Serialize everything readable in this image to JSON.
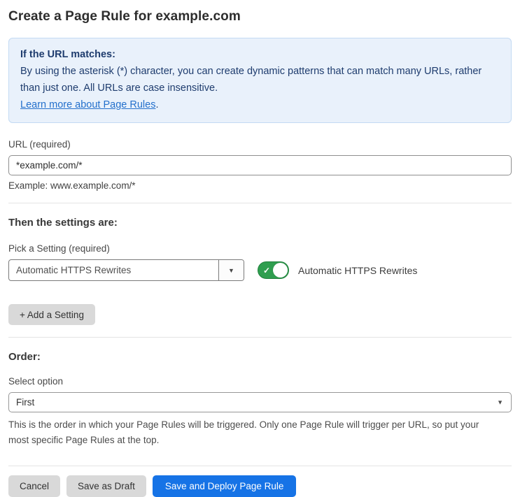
{
  "page": {
    "title": "Create a Page Rule for example.com"
  },
  "info_box": {
    "heading": "If the URL matches:",
    "body": "By using the asterisk (*) character, you can create dynamic patterns that can match many URLs, rather than just one. All URLs are case insensitive.",
    "link_label": "Learn more about Page Rules",
    "link_suffix": "."
  },
  "url_field": {
    "label": "URL (required)",
    "value": "*example.com/*",
    "hint": "Example: www.example.com/*"
  },
  "settings_section": {
    "heading": "Then the settings are:",
    "picker_label": "Pick a Setting (required)",
    "picker_value": "Automatic HTTPS Rewrites",
    "toggle_state": "on",
    "toggle_label": "Automatic HTTPS Rewrites",
    "add_setting_label": "+ Add a Setting"
  },
  "order_section": {
    "heading": "Order:",
    "select_label": "Select option",
    "select_value": "First",
    "help": "This is the order in which your Page Rules will be triggered. Only one Page Rule will trigger per URL, so put your most specific Page Rules at the top."
  },
  "footer": {
    "cancel_label": "Cancel",
    "save_draft_label": "Save as Draft",
    "save_deploy_label": "Save and Deploy Page Rule"
  },
  "icons": {
    "dropdown_arrow": "▼",
    "select_arrow": "▼",
    "toggle_check": "✓"
  },
  "colors": {
    "accent_blue": "#1673e6",
    "info_box_bg": "#e9f1fb",
    "info_box_border": "#c3daf3",
    "info_text": "#1e3c6e",
    "link_blue": "#2470cc",
    "toggle_green": "#2f9e4f",
    "button_gray": "#d9d9d9"
  }
}
